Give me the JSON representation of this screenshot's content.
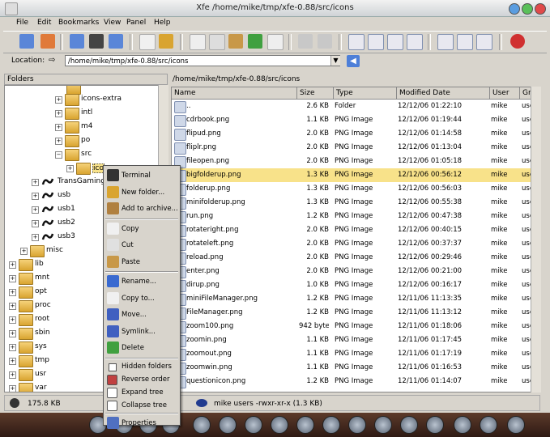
{
  "window": {
    "title": "Xfe   /home/mike/tmp/xfe-0.88/src/icons"
  },
  "menubar": [
    {
      "label": "File",
      "key": "F"
    },
    {
      "label": "Edit",
      "key": "E"
    },
    {
      "label": "Bookmarks",
      "key": "B"
    },
    {
      "label": "View",
      "key": "V"
    },
    {
      "label": "Panel",
      "key": "P"
    },
    {
      "label": "Help",
      "key": "H"
    }
  ],
  "location": {
    "label": "Location:",
    "value": "/home/mike/tmp/xfe-0.88/src/icons"
  },
  "left_panel": {
    "header": "Folders",
    "tree": [
      {
        "label": "icons-extra",
        "type": "folder"
      },
      {
        "label": "intl",
        "type": "folder"
      },
      {
        "label": "m4",
        "type": "folder"
      },
      {
        "label": "po",
        "type": "folder"
      },
      {
        "label": "src",
        "type": "folder"
      },
      {
        "label": "ico",
        "type": "folder"
      },
      {
        "label": "TransGaming",
        "type": "network"
      },
      {
        "label": "usb",
        "type": "network"
      },
      {
        "label": "usb1",
        "type": "network"
      },
      {
        "label": "usb2",
        "type": "network"
      },
      {
        "label": "usb3",
        "type": "network"
      },
      {
        "label": "misc",
        "type": "folder"
      },
      {
        "label": "lib",
        "type": "folder"
      },
      {
        "label": "mnt",
        "type": "folder"
      },
      {
        "label": "opt",
        "type": "folder"
      },
      {
        "label": "proc",
        "type": "folder"
      },
      {
        "label": "root",
        "type": "folder"
      },
      {
        "label": "sbin",
        "type": "folder"
      },
      {
        "label": "sys",
        "type": "folder"
      },
      {
        "label": "tmp",
        "type": "folder"
      },
      {
        "label": "usr",
        "type": "folder"
      },
      {
        "label": "var",
        "type": "folder"
      }
    ],
    "status": "175.8 KB"
  },
  "right_panel": {
    "path": "/home/mike/tmp/xfe-0.88/src/icons",
    "columns": [
      "Name",
      "Size",
      "Type",
      "Modified Date",
      "User",
      "Grou"
    ],
    "files": [
      {
        "name": "..",
        "size": "2.6 KB",
        "type": "Folder",
        "date": "12/12/06 01:22:10",
        "user": "mike",
        "group": "users"
      },
      {
        "name": "cdrbook.png",
        "size": "1.1 KB",
        "type": "PNG Image",
        "date": "12/12/06 01:19:44",
        "user": "mike",
        "group": "users"
      },
      {
        "name": "flipud.png",
        "size": "2.0 KB",
        "type": "PNG Image",
        "date": "12/12/06 01:14:58",
        "user": "mike",
        "group": "users"
      },
      {
        "name": "fliplr.png",
        "size": "2.0 KB",
        "type": "PNG Image",
        "date": "12/12/06 01:13:04",
        "user": "mike",
        "group": "users"
      },
      {
        "name": "fileopen.png",
        "size": "2.0 KB",
        "type": "PNG Image",
        "date": "12/12/06 01:05:18",
        "user": "mike",
        "group": "users"
      },
      {
        "name": "bigfolderup.png",
        "size": "1.3 KB",
        "type": "PNG Image",
        "date": "12/12/06 00:56:12",
        "user": "mike",
        "group": "users",
        "selected": true
      },
      {
        "name": "folderup.png",
        "size": "1.3 KB",
        "type": "PNG Image",
        "date": "12/12/06 00:56:03",
        "user": "mike",
        "group": "users"
      },
      {
        "name": "minifolderup.png",
        "size": "1.3 KB",
        "type": "PNG Image",
        "date": "12/12/06 00:55:38",
        "user": "mike",
        "group": "users"
      },
      {
        "name": "run.png",
        "size": "1.2 KB",
        "type": "PNG Image",
        "date": "12/12/06 00:47:38",
        "user": "mike",
        "group": "users"
      },
      {
        "name": "rotateright.png",
        "size": "2.0 KB",
        "type": "PNG Image",
        "date": "12/12/06 00:40:15",
        "user": "mike",
        "group": "users"
      },
      {
        "name": "rotateleft.png",
        "size": "2.0 KB",
        "type": "PNG Image",
        "date": "12/12/06 00:37:37",
        "user": "mike",
        "group": "users"
      },
      {
        "name": "reload.png",
        "size": "2.0 KB",
        "type": "PNG Image",
        "date": "12/12/06 00:29:46",
        "user": "mike",
        "group": "users"
      },
      {
        "name": "enter.png",
        "size": "2.0 KB",
        "type": "PNG Image",
        "date": "12/12/06 00:21:00",
        "user": "mike",
        "group": "users"
      },
      {
        "name": "dirup.png",
        "size": "1.0 KB",
        "type": "PNG Image",
        "date": "12/12/06 00:16:17",
        "user": "mike",
        "group": "users"
      },
      {
        "name": "miniFileManager.png",
        "size": "1.2 KB",
        "type": "PNG Image",
        "date": "12/11/06 11:13:35",
        "user": "mike",
        "group": "users"
      },
      {
        "name": "FileManager.png",
        "size": "1.2 KB",
        "type": "PNG Image",
        "date": "12/11/06 11:13:12",
        "user": "mike",
        "group": "users"
      },
      {
        "name": "zoom100.png",
        "size": "942 bytes",
        "type": "PNG Image",
        "date": "12/11/06 01:18:06",
        "user": "mike",
        "group": "users"
      },
      {
        "name": "zoomin.png",
        "size": "1.1 KB",
        "type": "PNG Image",
        "date": "12/11/06 01:17:45",
        "user": "mike",
        "group": "users"
      },
      {
        "name": "zoomout.png",
        "size": "1.1 KB",
        "type": "PNG Image",
        "date": "12/11/06 01:17:19",
        "user": "mike",
        "group": "users"
      },
      {
        "name": "zoomwin.png",
        "size": "1.1 KB",
        "type": "PNG Image",
        "date": "12/11/06 01:16:53",
        "user": "mike",
        "group": "users"
      },
      {
        "name": "questionicon.png",
        "size": "1.2 KB",
        "type": "PNG Image",
        "date": "12/11/06 01:14:07",
        "user": "mike",
        "group": "users"
      }
    ],
    "status": "mike users -rwxr-xr-x (1.3 KB)"
  },
  "context_menu": {
    "items": [
      {
        "label": "Terminal",
        "icon": "terminal-icon",
        "color": "#333333"
      },
      {
        "label": "New folder...",
        "icon": "new-folder-icon",
        "color": "#d9a430"
      },
      {
        "label": "Add to archive...",
        "icon": "archive-icon",
        "color": "#b08040"
      },
      {
        "sep": true
      },
      {
        "label": "Copy",
        "icon": "copy-icon",
        "color": "#f0f0f0"
      },
      {
        "label": "Cut",
        "icon": "cut-icon",
        "color": "#e0e0e0"
      },
      {
        "label": "Paste",
        "icon": "paste-icon",
        "color": "#c89848"
      },
      {
        "sep": true
      },
      {
        "label": "Rename...",
        "icon": "rename-icon",
        "color": "#3a6ad0"
      },
      {
        "label": "Copy to...",
        "icon": "copy-to-icon",
        "color": "#f0f0f0"
      },
      {
        "label": "Move...",
        "icon": "move-icon",
        "color": "#4060c0"
      },
      {
        "label": "Symlink...",
        "icon": "symlink-icon",
        "color": "#4060c0"
      },
      {
        "label": "Delete",
        "icon": "delete-icon",
        "color": "#40a040"
      },
      {
        "sep": true
      },
      {
        "label": "Hidden folders",
        "check": true
      },
      {
        "label": "Reverse order",
        "icon": "reverse-order-icon",
        "color": "#c04040"
      },
      {
        "label": "Expand tree",
        "icon": "expand-tree-icon",
        "color": "#ffffff"
      },
      {
        "label": "Collapse tree",
        "icon": "collapse-tree-icon",
        "color": "#ffffff"
      },
      {
        "sep": true
      },
      {
        "label": "Properties",
        "icon": "properties-icon",
        "color": "#5070c0"
      }
    ]
  },
  "colors": {
    "selection": "#f8e28a",
    "window_bg": "#d8d4cc",
    "accent": "#4d7fd8"
  }
}
